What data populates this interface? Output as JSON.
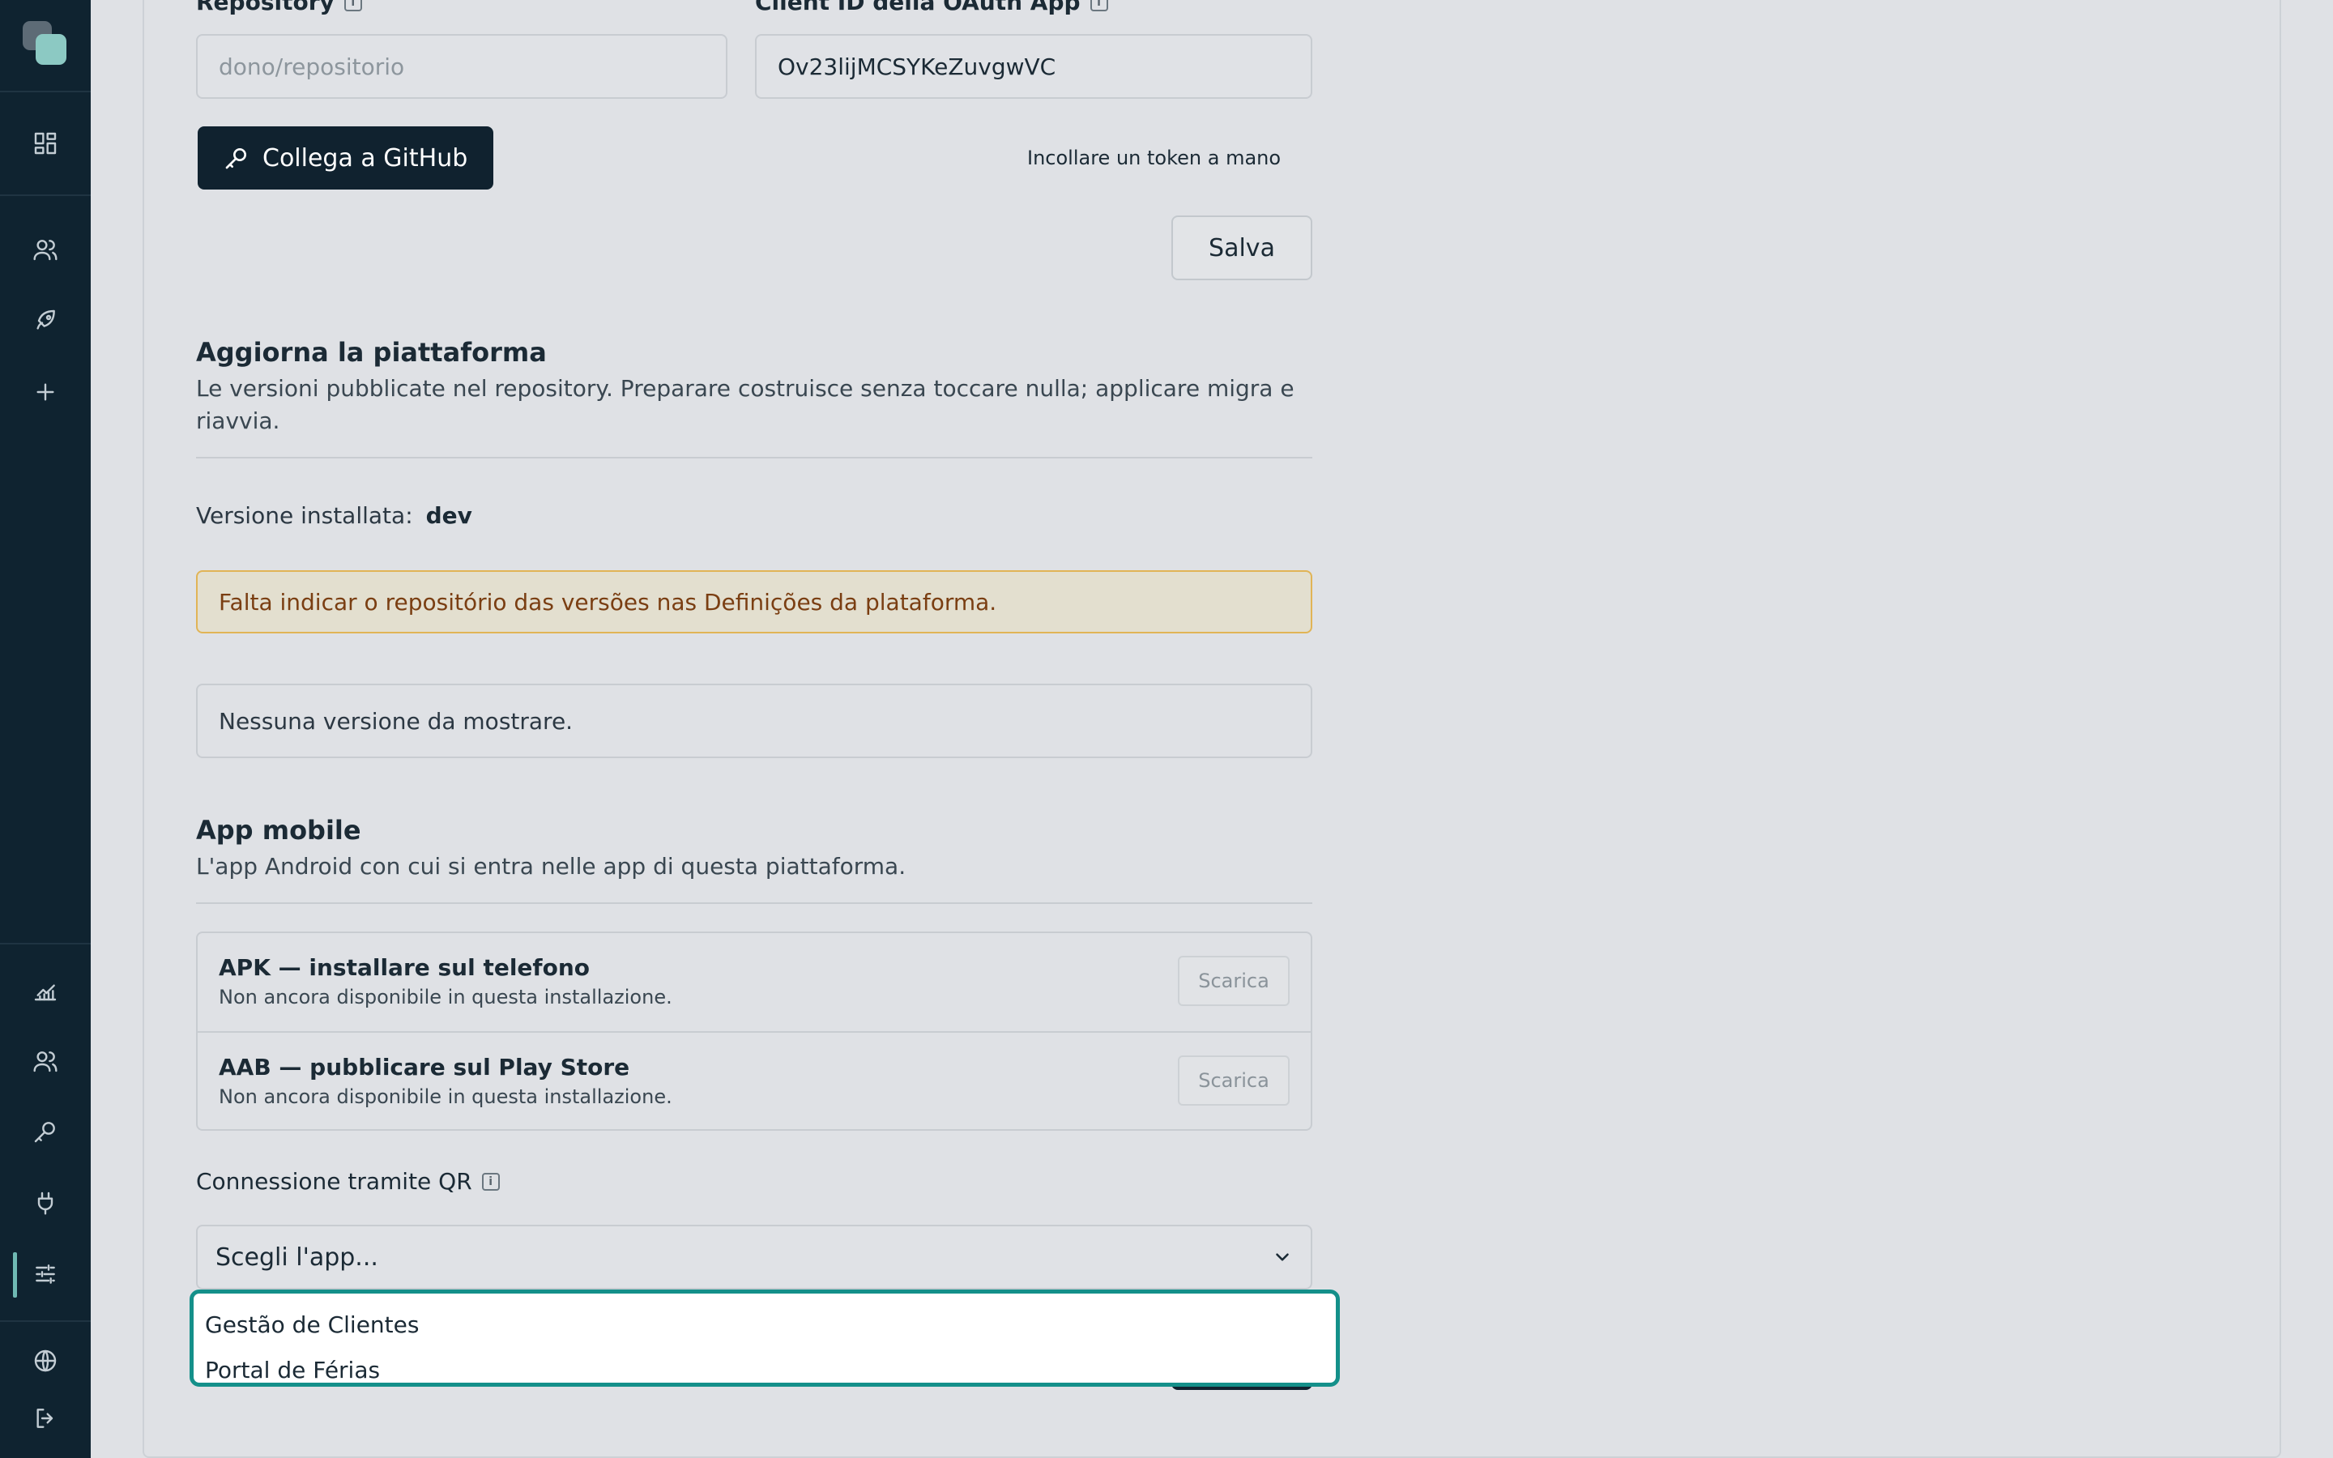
{
  "github": {
    "repository_label": "Repository",
    "repository_placeholder": "dono/repositorio",
    "client_id_label": "Client ID della OAuth App",
    "client_id_value": "Ov23lijMCSYKeZuvgwVC",
    "connect_button": "Collega a GitHub",
    "paste_token_link": "Incollare un token a mano",
    "save_button": "Salva"
  },
  "update": {
    "title": "Aggiorna la piattaforma",
    "description": "Le versioni pubblicate nel repository. Preparare costruisce senza toccare nulla; applicare migra e riavvia.",
    "installed_label": "Versione installata:",
    "installed_value": "dev",
    "warning": "Falta indicar o repositório das versões nas Definições da plataforma.",
    "empty": "Nessuna versione da mostrare."
  },
  "mobile": {
    "title": "App mobile",
    "description": "L'app Android con cui si entra nelle app di questa piattaforma.",
    "downloads": [
      {
        "title": "APK — installare sul telefono",
        "subtitle": "Non ancora disponibile in questa installazione.",
        "button": "Scarica"
      },
      {
        "title": "AAB — pubblicare sul Play Store",
        "subtitle": "Non ancora disponibile in questa installazione.",
        "button": "Scarica"
      }
    ]
  },
  "qr": {
    "label": "Connessione tramite QR",
    "select_value": "Scegli l'app...",
    "options": [
      "Gestão de Clientes",
      "Portal de Férias"
    ]
  },
  "sidebar": {
    "top_icons": [
      "dashboard-icon",
      "users-icon",
      "rocket-icon",
      "plus-icon"
    ],
    "bottom_icons": [
      "chart-icon",
      "users-icon",
      "key-icon",
      "plug-icon",
      "sliders-icon",
      "globe-icon",
      "logout-icon"
    ],
    "active": "sliders-icon"
  },
  "colors": {
    "sidebar_bg": "#0f2330",
    "accent": "#14908a",
    "warning_border": "#e1b456",
    "warning_text": "#7a3e12"
  }
}
